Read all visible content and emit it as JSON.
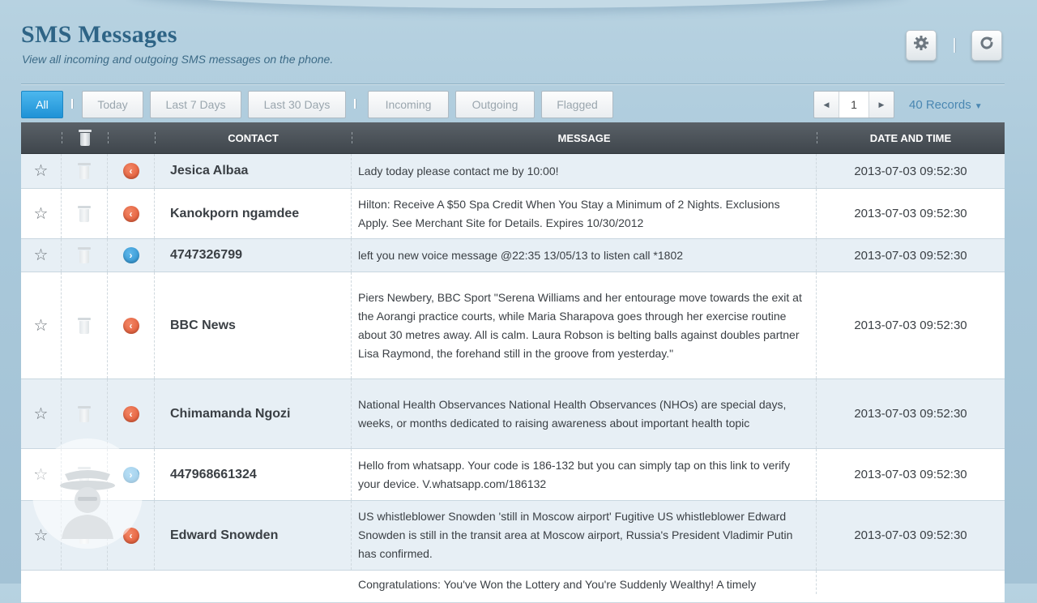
{
  "header": {
    "title": "SMS Messages",
    "subtitle": "View all incoming and outgoing SMS messages on the phone.",
    "settings_icon": "gear-icon",
    "refresh_icon": "refresh-icon"
  },
  "filters": {
    "all": "All",
    "today": "Today",
    "last7": "Last 7 Days",
    "last30": "Last 30 Days",
    "incoming": "Incoming",
    "outgoing": "Outgoing",
    "flagged": "Flagged",
    "active": "All"
  },
  "pagination": {
    "page": "1",
    "records": "40 Records"
  },
  "table": {
    "columns": {
      "contact": "CONTACT",
      "message": "MESSAGE",
      "date": "DATE AND TIME"
    },
    "rows": [
      {
        "contact": "Jesica Albaa",
        "direction": "incoming",
        "message": "Lady today please contact me by 10:00!",
        "date": "2013-07-03 09:52:30"
      },
      {
        "contact": "Kanokporn ngamdee",
        "direction": "incoming",
        "message": "Hilton: Receive A $50 Spa Credit When You Stay a Minimum of 2 Nights. Exclusions Apply. See Merchant Site for Details. Expires 10/30/2012",
        "date": "2013-07-03 09:52:30"
      },
      {
        "contact": "4747326799",
        "direction": "outgoing",
        "message": "left you new voice message @22:35 13/05/13 to listen call *1802",
        "date": "2013-07-03 09:52:30"
      },
      {
        "contact": "BBC News",
        "direction": "incoming",
        "message": "Piers Newbery, BBC Sport \"Serena Williams and her entourage move towards the exit at the Aorangi practice courts, while Maria Sharapova goes through her exercise routine about 30 metres away. All is calm. Laura Robson is belting balls against doubles partner Lisa Raymond, the forehand still in the groove from yesterday.\"",
        "date": "2013-07-03 09:52:30"
      },
      {
        "contact": "Chimamanda Ngozi",
        "direction": "incoming",
        "message": "National Health Observances National Health Observances (NHOs) are special days, weeks, or months dedicated to raising awareness about important health topic",
        "date": "2013-07-03 09:52:30"
      },
      {
        "contact": "447968661324",
        "direction": "outgoing",
        "message": "Hello from whatsapp. Your code is 186-132 but you can simply tap on this link to verify your device. V.whatsapp.com/186132",
        "date": "2013-07-03 09:52:30"
      },
      {
        "contact": "Edward Snowden",
        "direction": "incoming",
        "message": "US whistleblower Snowden 'still in Moscow airport' Fugitive US whistleblower Edward Snowden is still in the transit area at Moscow airport, Russia's President Vladimir Putin has confirmed.",
        "date": "2013-07-03 09:52:30"
      }
    ],
    "partial_row_message": "Congratulations: You've Won the Lottery and You're Suddenly Wealthy! A timely"
  }
}
